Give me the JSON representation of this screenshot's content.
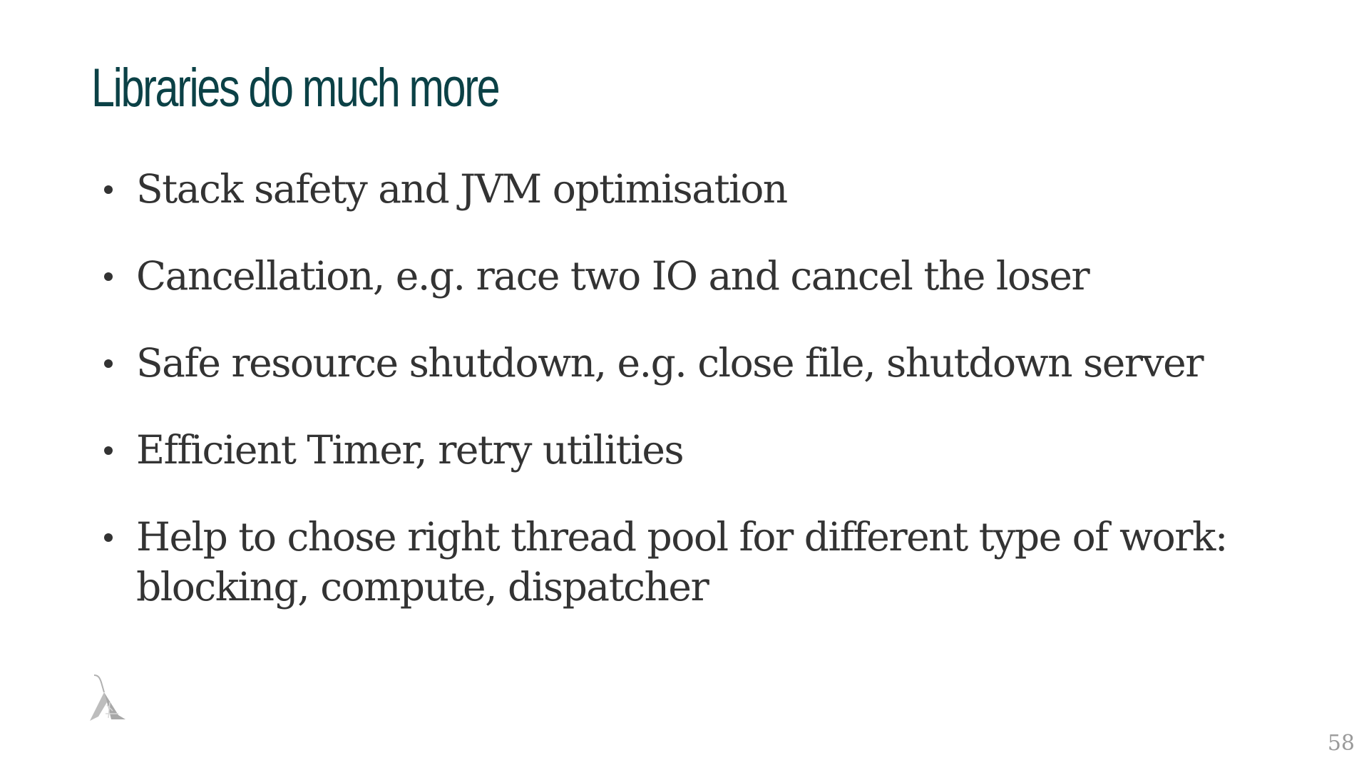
{
  "slide": {
    "title": "Libraries do much more",
    "bullets": [
      {
        "text": "Stack safety and JVM optimisation"
      },
      {
        "text": "Cancellation, e.g. race two IO and cancel the loser"
      },
      {
        "text": "Safe resource shutdown, e.g. close file, shutdown server"
      },
      {
        "text": "Efficient Timer, retry utilities"
      },
      {
        "text": "Help to chose right thread pool for different type of work: blocking, compute, dispatcher"
      }
    ],
    "page_number": "58",
    "logo_icon": "lambda-logo-icon",
    "colors": {
      "title": "#0b4146",
      "body_text": "#333333",
      "page_number": "#9a9a9a",
      "logo": "#b5b5b5"
    }
  }
}
